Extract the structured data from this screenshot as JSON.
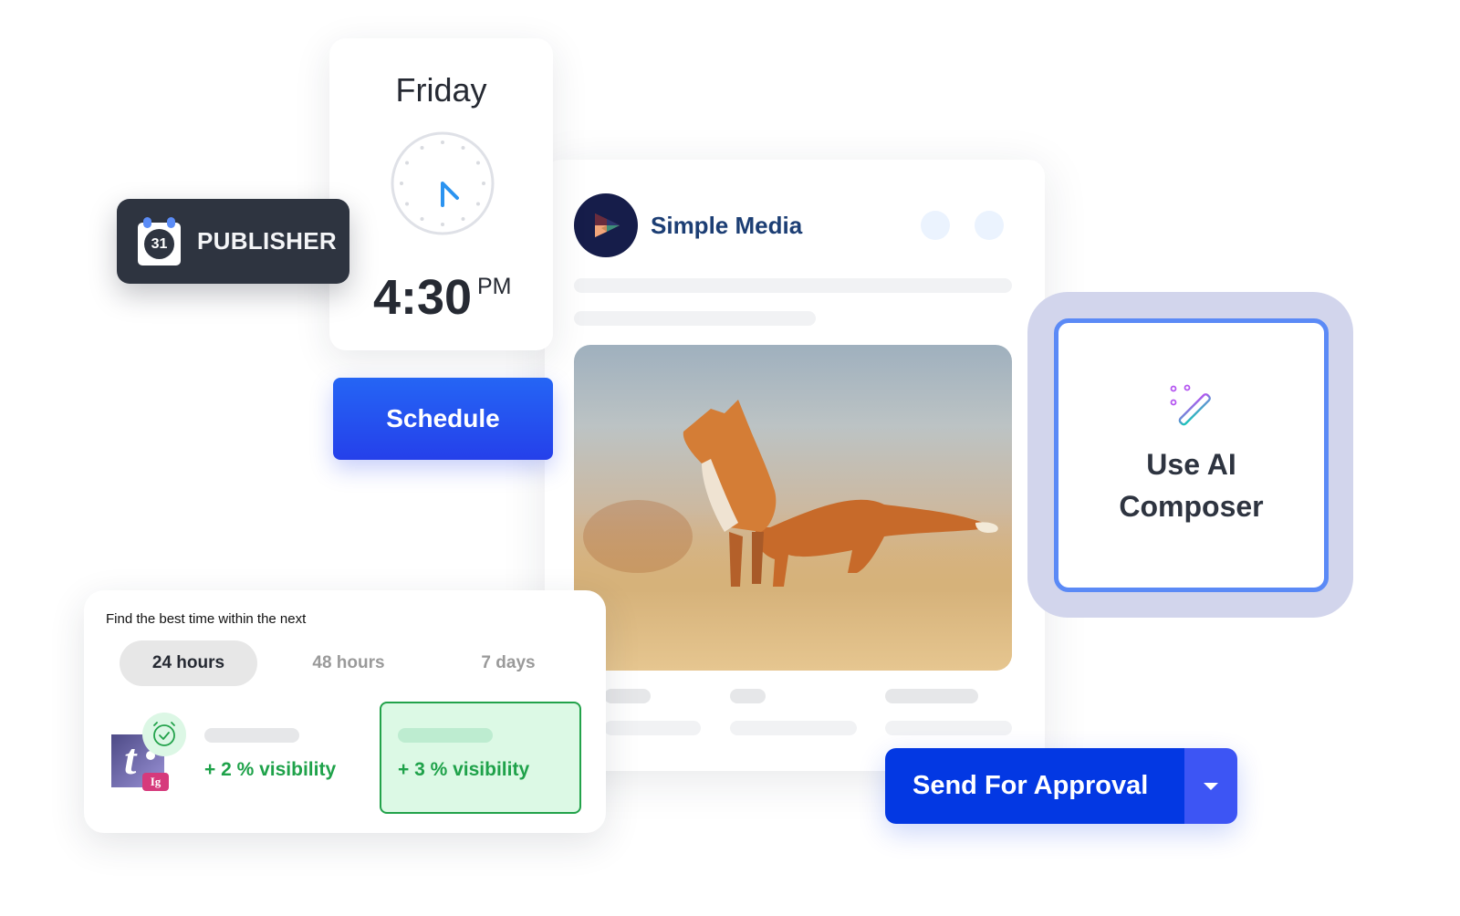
{
  "publisher": {
    "calendar_day": "31",
    "label": "PUBLISHER"
  },
  "clock_card": {
    "day": "Friday",
    "time": "4:30",
    "period": "PM"
  },
  "schedule": {
    "label": "Schedule"
  },
  "post": {
    "brand_name": "Simple Media",
    "image_description": "Red fox standing in golden grass"
  },
  "ai_composer": {
    "line1": "Use AI",
    "line2": "Composer",
    "icon": "magic-wand-icon"
  },
  "best_time": {
    "title": "Find the best time within the next",
    "tabs": [
      {
        "label": "24 hours",
        "active": true
      },
      {
        "label": "48 hours",
        "active": false
      },
      {
        "label": "7 days",
        "active": false
      }
    ],
    "account_badge": "Ig",
    "options": [
      {
        "label": "+ 2 % visibility",
        "selected": false
      },
      {
        "label": "+ 3 % visibility",
        "selected": true
      }
    ]
  },
  "send_approval": {
    "label": "Send For Approval"
  },
  "colors": {
    "primary": "#0338e3",
    "schedule": "#2553ef",
    "success": "#1fa24a",
    "dark": "#2e3440",
    "brand_text": "#1c3e74"
  }
}
